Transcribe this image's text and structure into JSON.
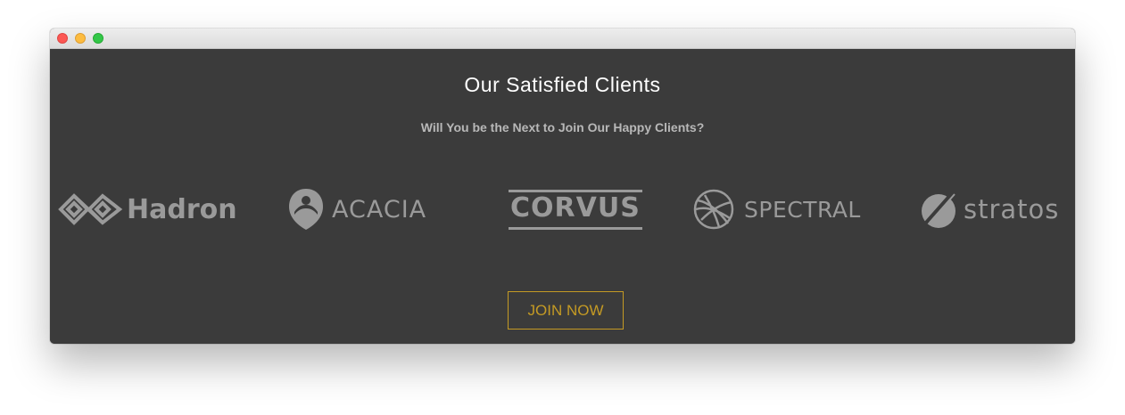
{
  "window": {
    "controls": {
      "close": "close-icon",
      "minimize": "minimize-icon",
      "maximize": "maximize-icon"
    }
  },
  "section": {
    "heading": "Our Satisfied Clients",
    "subheading": "Will You be the Next to Join Our Happy Clients?",
    "logos": [
      {
        "name": "Hadron",
        "icon": "hadron-logo-icon"
      },
      {
        "name": "ACACIA",
        "icon": "acacia-logo-icon"
      },
      {
        "name": "CORVUS",
        "icon": "corvus-logo-icon"
      },
      {
        "name": "SPECTRAL",
        "icon": "spectral-logo-icon"
      },
      {
        "name": "stratos",
        "icon": "stratos-logo-icon"
      }
    ],
    "cta_label": "JOIN NOW"
  },
  "colors": {
    "background": "#3b3b3b",
    "heading": "#ffffff",
    "subheading": "#b8b8b8",
    "logo": "#9a9a9a",
    "accent": "#c49a24"
  }
}
